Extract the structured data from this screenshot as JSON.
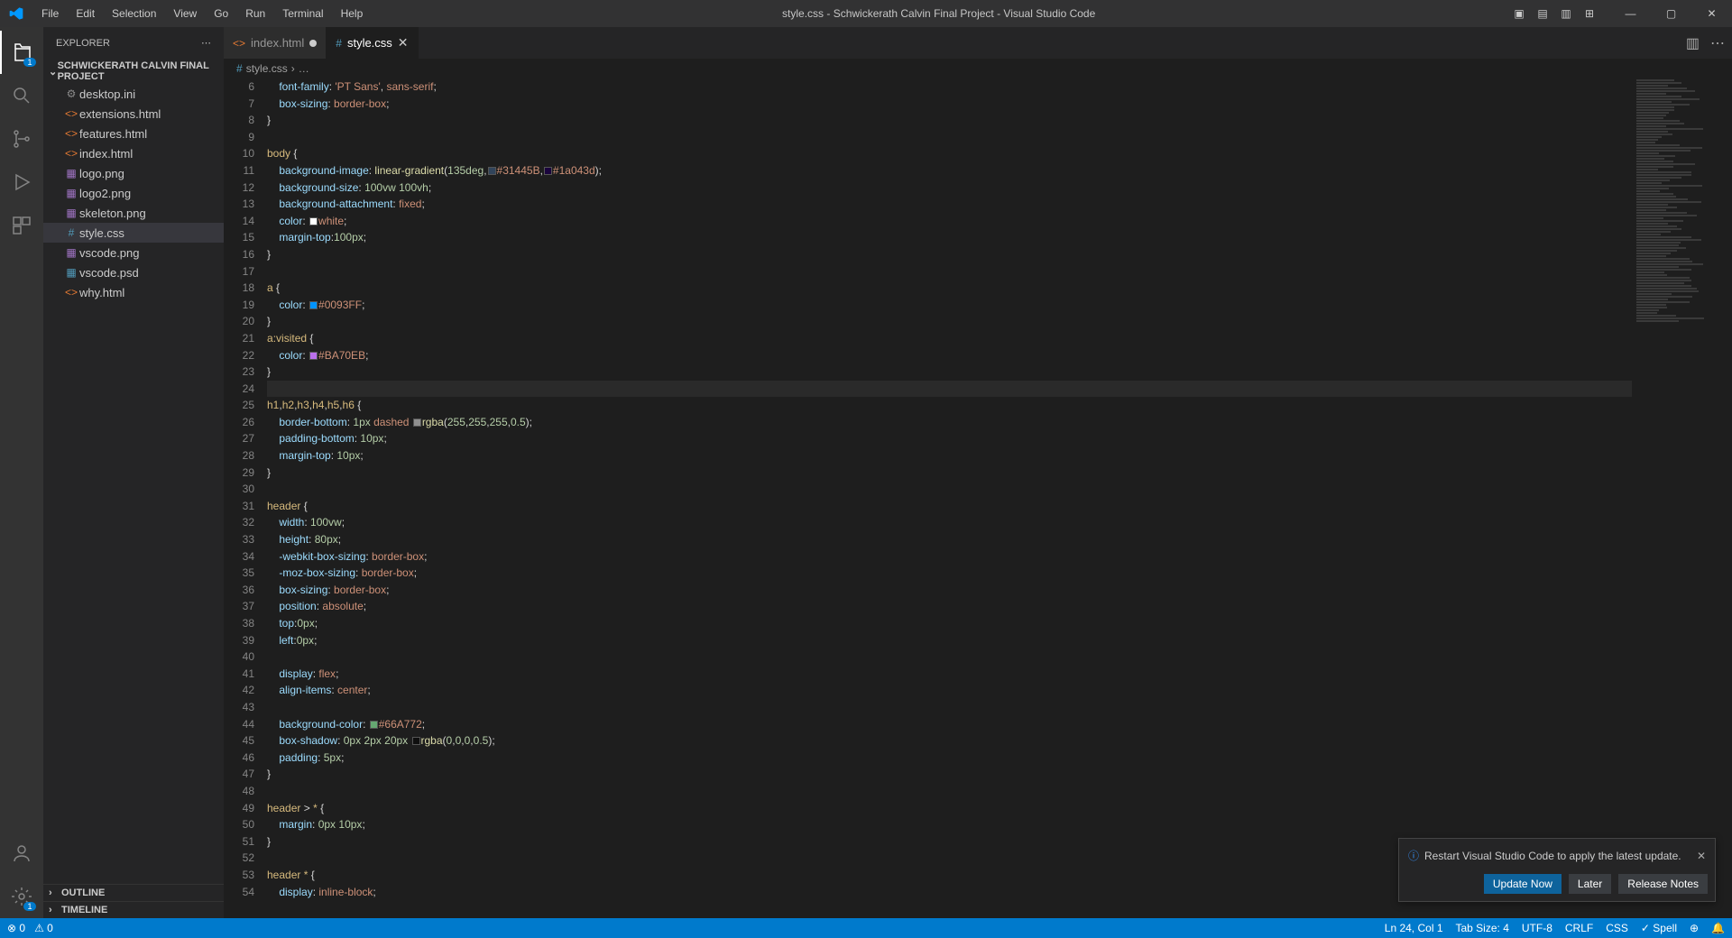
{
  "title": "style.css - Schwickerath Calvin Final Project - Visual Studio Code",
  "menu": [
    "File",
    "Edit",
    "Selection",
    "View",
    "Go",
    "Run",
    "Terminal",
    "Help"
  ],
  "sidebar": {
    "title": "EXPLORER",
    "folder": "SCHWICKERATH CALVIN FINAL PROJECT",
    "files": [
      {
        "name": "desktop.ini",
        "icon": "⚙",
        "cls": "ic-gray"
      },
      {
        "name": "extensions.html",
        "icon": "<>",
        "cls": "ic-orange"
      },
      {
        "name": "features.html",
        "icon": "<>",
        "cls": "ic-orange"
      },
      {
        "name": "index.html",
        "icon": "<>",
        "cls": "ic-orange"
      },
      {
        "name": "logo.png",
        "icon": "▦",
        "cls": "ic-purple"
      },
      {
        "name": "logo2.png",
        "icon": "▦",
        "cls": "ic-purple"
      },
      {
        "name": "skeleton.png",
        "icon": "▦",
        "cls": "ic-purple"
      },
      {
        "name": "style.css",
        "icon": "#",
        "cls": "ic-blue",
        "selected": true
      },
      {
        "name": "vscode.png",
        "icon": "▦",
        "cls": "ic-purple"
      },
      {
        "name": "vscode.psd",
        "icon": "▦",
        "cls": "ic-blue"
      },
      {
        "name": "why.html",
        "icon": "<>",
        "cls": "ic-orange"
      }
    ],
    "sections": [
      "OUTLINE",
      "TIMELINE"
    ]
  },
  "tabs": [
    {
      "name": "index.html",
      "icon": "<>",
      "cls": "ic-orange",
      "dirty": true
    },
    {
      "name": "style.css",
      "icon": "#",
      "cls": "ic-blue",
      "active": true
    }
  ],
  "breadcrumb": {
    "file": "style.css",
    "more": "…"
  },
  "code_lines": [
    {
      "n": 6,
      "html": "    <span class='prop'>font-family</span><span class='punc'>: </span><span class='val'>'PT Sans'</span><span class='punc'>, </span><span class='val'>sans-serif</span><span class='punc'>;</span>"
    },
    {
      "n": 7,
      "html": "    <span class='prop'>box-sizing</span><span class='punc'>: </span><span class='val'>border-box</span><span class='punc'>;</span>"
    },
    {
      "n": 8,
      "html": "<span class='punc'>}</span>"
    },
    {
      "n": 9,
      "html": ""
    },
    {
      "n": 10,
      "html": "<span class='sel'>body</span> <span class='punc'>{</span>"
    },
    {
      "n": 11,
      "html": "    <span class='prop'>background-image</span><span class='punc'>: </span><span class='fn'>linear-gradient</span><span class='punc'>(</span><span class='num'>135deg</span><span class='punc'>,</span><span class='swatch' style='background:#31445B'></span><span class='val'>#31445B</span><span class='punc'>,</span><span class='swatch' style='background:#1a043d'></span><span class='val'>#1a043d</span><span class='punc'>);</span>"
    },
    {
      "n": 12,
      "html": "    <span class='prop'>background-size</span><span class='punc'>: </span><span class='num'>100vw</span> <span class='num'>100vh</span><span class='punc'>;</span>"
    },
    {
      "n": 13,
      "html": "    <span class='prop'>background-attachment</span><span class='punc'>: </span><span class='val'>fixed</span><span class='punc'>;</span>"
    },
    {
      "n": 14,
      "html": "    <span class='prop'>color</span><span class='punc'>: </span><span class='swatch' style='background:#ffffff'></span><span class='val'>white</span><span class='punc'>;</span>"
    },
    {
      "n": 15,
      "html": "    <span class='prop'>margin-top</span><span class='punc'>:</span><span class='num'>100px</span><span class='punc'>;</span>"
    },
    {
      "n": 16,
      "html": "<span class='punc'>}</span>"
    },
    {
      "n": 17,
      "html": ""
    },
    {
      "n": 18,
      "html": "<span class='sel'>a</span> <span class='punc'>{</span>"
    },
    {
      "n": 19,
      "html": "    <span class='prop'>color</span><span class='punc'>: </span><span class='swatch' style='background:#0093FF'></span><span class='val'>#0093FF</span><span class='punc'>;</span>"
    },
    {
      "n": 20,
      "html": "<span class='punc'>}</span>"
    },
    {
      "n": 21,
      "html": "<span class='sel'>a</span><span class='pseudo'>:visited</span> <span class='punc'>{</span>"
    },
    {
      "n": 22,
      "html": "    <span class='prop'>color</span><span class='punc'>: </span><span class='swatch' style='background:#BA70EB'></span><span class='val'>#BA70EB</span><span class='punc'>;</span>"
    },
    {
      "n": 23,
      "html": "<span class='punc'>}</span>"
    },
    {
      "n": 24,
      "html": "",
      "current": true
    },
    {
      "n": 25,
      "html": "<span class='sel'>h1</span><span class='punc'>,</span><span class='sel'>h2</span><span class='punc'>,</span><span class='sel'>h3</span><span class='punc'>,</span><span class='sel'>h4</span><span class='punc'>,</span><span class='sel'>h5</span><span class='punc'>,</span><span class='sel'>h6</span> <span class='punc'>{</span>"
    },
    {
      "n": 26,
      "html": "    <span class='prop'>border-bottom</span><span class='punc'>: </span><span class='num'>1px</span> <span class='val'>dashed</span> <span class='swatch' style='background:rgba(255,255,255,0.5)'></span><span class='fn'>rgba</span><span class='punc'>(</span><span class='num'>255</span><span class='punc'>,</span><span class='num'>255</span><span class='punc'>,</span><span class='num'>255</span><span class='punc'>,</span><span class='num'>0.5</span><span class='punc'>);</span>"
    },
    {
      "n": 27,
      "html": "    <span class='prop'>padding-bottom</span><span class='punc'>: </span><span class='num'>10px</span><span class='punc'>;</span>"
    },
    {
      "n": 28,
      "html": "    <span class='prop'>margin-top</span><span class='punc'>: </span><span class='num'>10px</span><span class='punc'>;</span>"
    },
    {
      "n": 29,
      "html": "<span class='punc'>}</span>"
    },
    {
      "n": 30,
      "html": ""
    },
    {
      "n": 31,
      "html": "<span class='sel'>header</span> <span class='punc'>{</span>"
    },
    {
      "n": 32,
      "html": "    <span class='prop'>width</span><span class='punc'>: </span><span class='num'>100vw</span><span class='punc'>;</span>"
    },
    {
      "n": 33,
      "html": "    <span class='prop'>height</span><span class='punc'>: </span><span class='num'>80px</span><span class='punc'>;</span>"
    },
    {
      "n": 34,
      "html": "    <span class='prop'>-webkit-box-sizing</span><span class='punc'>: </span><span class='val'>border-box</span><span class='punc'>;</span>"
    },
    {
      "n": 35,
      "html": "    <span class='prop'>-moz-box-sizing</span><span class='punc'>: </span><span class='val'>border-box</span><span class='punc'>;</span>"
    },
    {
      "n": 36,
      "html": "    <span class='prop'>box-sizing</span><span class='punc'>: </span><span class='val'>border-box</span><span class='punc'>;</span>"
    },
    {
      "n": 37,
      "html": "    <span class='prop'>position</span><span class='punc'>: </span><span class='val'>absolute</span><span class='punc'>;</span>"
    },
    {
      "n": 38,
      "html": "    <span class='prop'>top</span><span class='punc'>:</span><span class='num'>0px</span><span class='punc'>;</span>"
    },
    {
      "n": 39,
      "html": "    <span class='prop'>left</span><span class='punc'>:</span><span class='num'>0px</span><span class='punc'>;</span>"
    },
    {
      "n": 40,
      "html": ""
    },
    {
      "n": 41,
      "html": "    <span class='prop'>display</span><span class='punc'>: </span><span class='val'>flex</span><span class='punc'>;</span>"
    },
    {
      "n": 42,
      "html": "    <span class='prop'>align-items</span><span class='punc'>: </span><span class='val'>center</span><span class='punc'>;</span>"
    },
    {
      "n": 43,
      "html": ""
    },
    {
      "n": 44,
      "html": "    <span class='prop'>background-color</span><span class='punc'>: </span><span class='swatch' style='background:#66A772'></span><span class='val'>#66A772</span><span class='punc'>;</span>"
    },
    {
      "n": 45,
      "html": "    <span class='prop'>box-shadow</span><span class='punc'>: </span><span class='num'>0px</span> <span class='num'>2px</span> <span class='num'>20px</span> <span class='swatch' style='background:rgba(0,0,0,0.5)'></span><span class='fn'>rgba</span><span class='punc'>(</span><span class='num'>0</span><span class='punc'>,</span><span class='num'>0</span><span class='punc'>,</span><span class='num'>0</span><span class='punc'>,</span><span class='num'>0.5</span><span class='punc'>);</span>"
    },
    {
      "n": 46,
      "html": "    <span class='prop'>padding</span><span class='punc'>: </span><span class='num'>5px</span><span class='punc'>;</span>"
    },
    {
      "n": 47,
      "html": "<span class='punc'>}</span>"
    },
    {
      "n": 48,
      "html": ""
    },
    {
      "n": 49,
      "html": "<span class='sel'>header</span> <span class='punc'>&gt;</span> <span class='sel'>*</span> <span class='punc'>{</span>"
    },
    {
      "n": 50,
      "html": "    <span class='prop'>margin</span><span class='punc'>: </span><span class='num'>0px</span> <span class='num'>10px</span><span class='punc'>;</span>"
    },
    {
      "n": 51,
      "html": "<span class='punc'>}</span>"
    },
    {
      "n": 52,
      "html": ""
    },
    {
      "n": 53,
      "html": "<span class='sel'>header</span> <span class='sel'>*</span> <span class='punc'>{</span>"
    },
    {
      "n": 54,
      "html": "    <span class='prop'>display</span><span class='punc'>: </span><span class='val'>inline-block</span><span class='punc'>;</span>"
    }
  ],
  "notification": {
    "message": "Restart Visual Studio Code to apply the latest update.",
    "buttons": [
      "Update Now",
      "Later",
      "Release Notes"
    ]
  },
  "status": {
    "left": [
      "⊗ 0",
      "⚠ 0"
    ],
    "right": [
      "Ln 24, Col 1",
      "Tab Size: 4",
      "UTF-8",
      "CRLF",
      "CSS",
      "✓ Spell",
      "⊕",
      "🔔"
    ]
  }
}
